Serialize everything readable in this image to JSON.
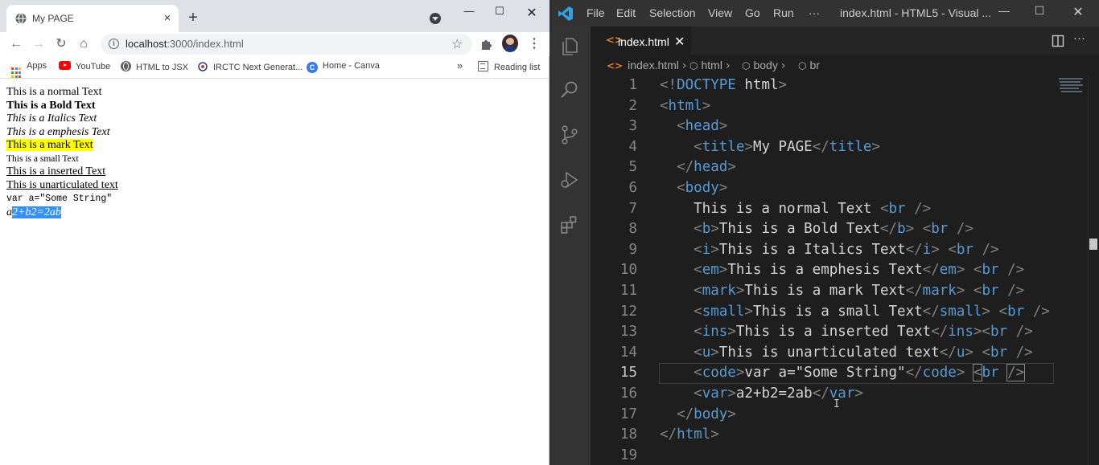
{
  "browser": {
    "tab_title": "My PAGE",
    "new_tab_symbol": "+",
    "close_tab_symbol": "×",
    "url_host": "localhost",
    "url_rest": ":3000/index.html",
    "bookmarks": {
      "apps": "Apps",
      "youtube": "YouTube",
      "html_to_jsx": "HTML to JSX",
      "irctc": "IRCTC Next Generat...",
      "canva": "Home - Canva",
      "more": "»",
      "reading_list": "Reading list"
    },
    "page": {
      "normal": "This is a normal Text",
      "bold": "This is a Bold Text",
      "italics": "This is a Italics Text",
      "emphasis": "This is a emphesis Text",
      "mark": "This is a mark Text",
      "small": "This is a small Text",
      "inserted": "This is a inserted Text",
      "unarticulated": "This is unarticulated text",
      "code": "var a=\"Some String\"",
      "var_first": "a",
      "var_rest": "2+b2=2ab"
    }
  },
  "vscode": {
    "menu": [
      "File",
      "Edit",
      "Selection",
      "View",
      "Go",
      "Run",
      "···"
    ],
    "window_title": "index.html - HTML5 - Visual ...",
    "tab_name": "index.html",
    "breadcrumbs": [
      "index.html",
      "html",
      "body",
      "br"
    ],
    "current_line": 15,
    "lines": [
      {
        "n": "1",
        "tokens": [
          [
            "b",
            "<!"
          ],
          [
            "t",
            "DOCTYPE"
          ],
          [
            "x",
            " "
          ],
          [
            "x",
            "html"
          ],
          [
            "b",
            ">"
          ]
        ]
      },
      {
        "n": "2",
        "tokens": [
          [
            "b",
            "<"
          ],
          [
            "t",
            "html"
          ],
          [
            "b",
            ">"
          ]
        ]
      },
      {
        "n": "3",
        "tokens": [
          [
            "x",
            "  "
          ],
          [
            "b",
            "<"
          ],
          [
            "t",
            "head"
          ],
          [
            "b",
            ">"
          ]
        ]
      },
      {
        "n": "4",
        "tokens": [
          [
            "x",
            "    "
          ],
          [
            "b",
            "<"
          ],
          [
            "t",
            "title"
          ],
          [
            "b",
            ">"
          ],
          [
            "x",
            "My PAGE"
          ],
          [
            "b",
            "</"
          ],
          [
            "t",
            "title"
          ],
          [
            "b",
            ">"
          ]
        ]
      },
      {
        "n": "5",
        "tokens": [
          [
            "x",
            "  "
          ],
          [
            "b",
            "</"
          ],
          [
            "t",
            "head"
          ],
          [
            "b",
            ">"
          ]
        ]
      },
      {
        "n": "6",
        "tokens": [
          [
            "x",
            "  "
          ],
          [
            "b",
            "<"
          ],
          [
            "t",
            "body"
          ],
          [
            "b",
            ">"
          ]
        ]
      },
      {
        "n": "7",
        "tokens": [
          [
            "x",
            "    This is a normal Text "
          ],
          [
            "b",
            "<"
          ],
          [
            "t",
            "br"
          ],
          [
            "x",
            " "
          ],
          [
            "b",
            "/>"
          ]
        ]
      },
      {
        "n": "8",
        "tokens": [
          [
            "x",
            "    "
          ],
          [
            "b",
            "<"
          ],
          [
            "t",
            "b"
          ],
          [
            "b",
            ">"
          ],
          [
            "x",
            "This is a Bold Text"
          ],
          [
            "b",
            "</"
          ],
          [
            "t",
            "b"
          ],
          [
            "b",
            ">"
          ],
          [
            "x",
            " "
          ],
          [
            "b",
            "<"
          ],
          [
            "t",
            "br"
          ],
          [
            "x",
            " "
          ],
          [
            "b",
            "/>"
          ]
        ]
      },
      {
        "n": "9",
        "tokens": [
          [
            "x",
            "    "
          ],
          [
            "b",
            "<"
          ],
          [
            "t",
            "i"
          ],
          [
            "b",
            ">"
          ],
          [
            "x",
            "This is a Italics Text"
          ],
          [
            "b",
            "</"
          ],
          [
            "t",
            "i"
          ],
          [
            "b",
            ">"
          ],
          [
            "x",
            " "
          ],
          [
            "b",
            "<"
          ],
          [
            "t",
            "br"
          ],
          [
            "x",
            " "
          ],
          [
            "b",
            "/>"
          ]
        ]
      },
      {
        "n": "10",
        "tokens": [
          [
            "x",
            "    "
          ],
          [
            "b",
            "<"
          ],
          [
            "t",
            "em"
          ],
          [
            "b",
            ">"
          ],
          [
            "x",
            "This is a emphesis Text"
          ],
          [
            "b",
            "</"
          ],
          [
            "t",
            "em"
          ],
          [
            "b",
            ">"
          ],
          [
            "x",
            " "
          ],
          [
            "b",
            "<"
          ],
          [
            "t",
            "br"
          ],
          [
            "x",
            " "
          ],
          [
            "b",
            "/>"
          ]
        ]
      },
      {
        "n": "11",
        "tokens": [
          [
            "x",
            "    "
          ],
          [
            "b",
            "<"
          ],
          [
            "t",
            "mark"
          ],
          [
            "b",
            ">"
          ],
          [
            "x",
            "This is a mark Text"
          ],
          [
            "b",
            "</"
          ],
          [
            "t",
            "mark"
          ],
          [
            "b",
            ">"
          ],
          [
            "x",
            " "
          ],
          [
            "b",
            "<"
          ],
          [
            "t",
            "br"
          ],
          [
            "x",
            " "
          ],
          [
            "b",
            "/>"
          ]
        ]
      },
      {
        "n": "12",
        "tokens": [
          [
            "x",
            "    "
          ],
          [
            "b",
            "<"
          ],
          [
            "t",
            "small"
          ],
          [
            "b",
            ">"
          ],
          [
            "x",
            "This is a small Text"
          ],
          [
            "b",
            "</"
          ],
          [
            "t",
            "small"
          ],
          [
            "b",
            ">"
          ],
          [
            "x",
            " "
          ],
          [
            "b",
            "<"
          ],
          [
            "t",
            "br"
          ],
          [
            "x",
            " "
          ],
          [
            "b",
            "/>"
          ]
        ]
      },
      {
        "n": "13",
        "tokens": [
          [
            "x",
            "    "
          ],
          [
            "b",
            "<"
          ],
          [
            "t",
            "ins"
          ],
          [
            "b",
            ">"
          ],
          [
            "x",
            "This is a inserted Text"
          ],
          [
            "b",
            "</"
          ],
          [
            "t",
            "ins"
          ],
          [
            "b",
            ">"
          ],
          [
            "b",
            "<"
          ],
          [
            "t",
            "br"
          ],
          [
            "x",
            " "
          ],
          [
            "b",
            "/>"
          ]
        ]
      },
      {
        "n": "14",
        "tokens": [
          [
            "x",
            "    "
          ],
          [
            "b",
            "<"
          ],
          [
            "t",
            "u"
          ],
          [
            "b",
            ">"
          ],
          [
            "x",
            "This is unarticulated text"
          ],
          [
            "b",
            "</"
          ],
          [
            "t",
            "u"
          ],
          [
            "b",
            ">"
          ],
          [
            "x",
            " "
          ],
          [
            "b",
            "<"
          ],
          [
            "t",
            "br"
          ],
          [
            "x",
            " "
          ],
          [
            "b",
            "/>"
          ]
        ]
      },
      {
        "n": "15",
        "tokens": [
          [
            "x",
            "    "
          ],
          [
            "b",
            "<"
          ],
          [
            "t",
            "code"
          ],
          [
            "b",
            ">"
          ],
          [
            "x",
            "var a=\"Some String\""
          ],
          [
            "b",
            "</"
          ],
          [
            "t",
            "code"
          ],
          [
            "b",
            ">"
          ],
          [
            "x",
            " "
          ],
          [
            "bc",
            "<"
          ],
          [
            "t",
            "br"
          ],
          [
            "x",
            " "
          ],
          [
            "bc",
            "/>"
          ]
        ]
      },
      {
        "n": "16",
        "tokens": [
          [
            "x",
            "    "
          ],
          [
            "b",
            "<"
          ],
          [
            "t",
            "var"
          ],
          [
            "b",
            ">"
          ],
          [
            "x",
            "a2+b2=2ab"
          ],
          [
            "b",
            "</"
          ],
          [
            "t",
            "var"
          ],
          [
            "b",
            ">"
          ]
        ]
      },
      {
        "n": "17",
        "tokens": [
          [
            "x",
            "  "
          ],
          [
            "b",
            "</"
          ],
          [
            "t",
            "body"
          ],
          [
            "b",
            ">"
          ]
        ]
      },
      {
        "n": "18",
        "tokens": [
          [
            "b",
            "</"
          ],
          [
            "t",
            "html"
          ],
          [
            "b",
            ">"
          ]
        ]
      },
      {
        "n": "19",
        "tokens": []
      }
    ]
  },
  "colors": {
    "tag": "#569cd6",
    "bracket": "#808080",
    "text": "#d4d4d4",
    "mark_highlight": "#ffff00",
    "selection": "#3390ff"
  }
}
